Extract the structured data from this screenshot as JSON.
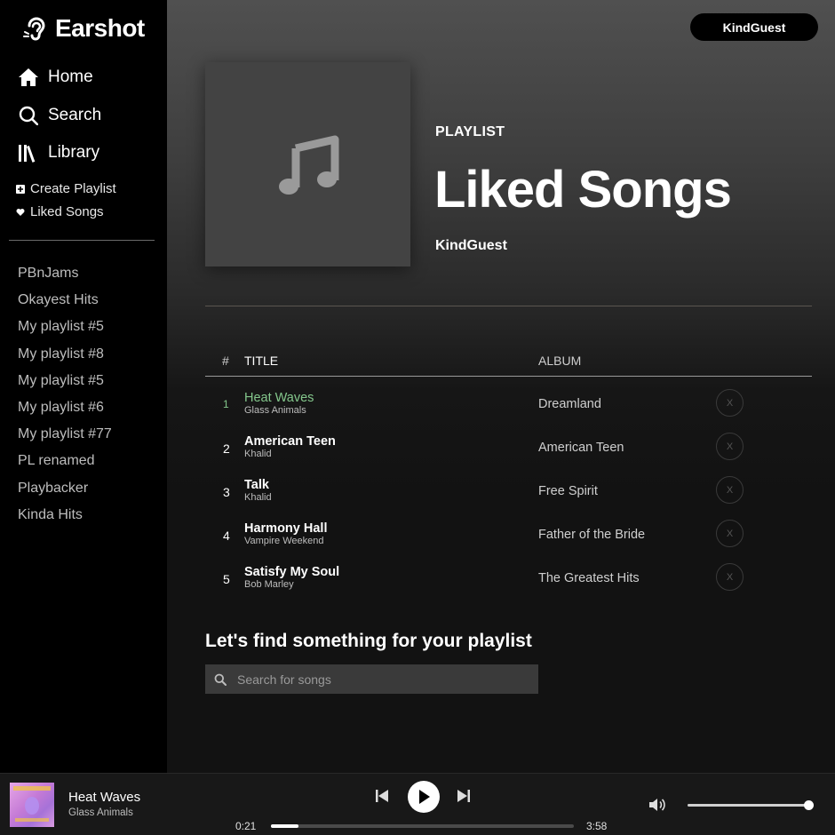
{
  "app": {
    "name": "Earshot"
  },
  "nav": [
    {
      "label": "Home",
      "icon": "home-icon"
    },
    {
      "label": "Search",
      "icon": "search-icon"
    },
    {
      "label": "Library",
      "icon": "library-icon"
    }
  ],
  "library_actions": [
    {
      "label": "Create Playlist",
      "icon": "plus-square-icon"
    },
    {
      "label": "Liked Songs",
      "icon": "heart-icon"
    }
  ],
  "playlists": [
    "PBnJams",
    "Okayest Hits",
    "My playlist #5",
    "My playlist #8",
    "My playlist #5",
    "My playlist #6",
    "My playlist #77",
    "PL renamed",
    "Playbacker",
    "Kinda Hits"
  ],
  "user": {
    "name": "KindGuest"
  },
  "header": {
    "type": "PLAYLIST",
    "title": "Liked Songs",
    "owner": "KindGuest",
    "cover_icon": "music-note-icon"
  },
  "table": {
    "columns": {
      "num": "#",
      "title": "TITLE",
      "album": "ALBUM"
    },
    "remove_label": "X",
    "tracks": [
      {
        "num": "1",
        "title": "Heat Waves",
        "artist": "Glass Animals",
        "album": "Dreamland",
        "active": true
      },
      {
        "num": "2",
        "title": "American Teen",
        "artist": "Khalid",
        "album": "American Teen",
        "active": false
      },
      {
        "num": "3",
        "title": "Talk",
        "artist": "Khalid",
        "album": "Free Spirit",
        "active": false
      },
      {
        "num": "4",
        "title": "Harmony Hall",
        "artist": "Vampire Weekend",
        "album": "Father of the Bride",
        "active": false
      },
      {
        "num": "5",
        "title": "Satisfy My Soul",
        "artist": "Bob Marley",
        "album": "The Greatest Hits",
        "active": false
      }
    ]
  },
  "find": {
    "title": "Let's find something for your playlist",
    "placeholder": "Search for songs",
    "value": ""
  },
  "player": {
    "title": "Heat Waves",
    "artist": "Glass Animals",
    "current_time": "0:21",
    "total_time": "3:58",
    "progress_fraction": 0.09,
    "volume_fraction": 1.0
  },
  "colors": {
    "accent_green": "#84c78c",
    "sidebar_bg": "#000000",
    "main_bg": "#121212"
  }
}
